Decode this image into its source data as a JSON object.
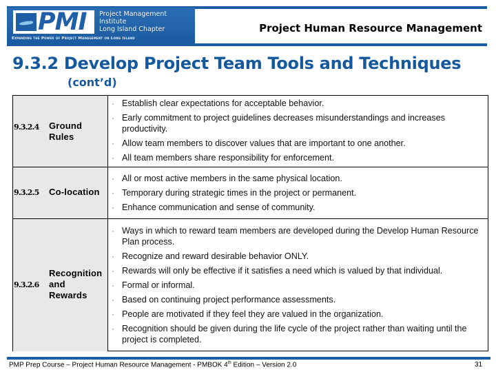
{
  "header": {
    "logo": {
      "letters": "PMI",
      "org_line1": "Project Management Institute",
      "org_line2": "Long Island Chapter",
      "tagline": "Expanding the Power of Project Management on Long Island"
    },
    "section_title": "Project Human Resource Management",
    "brand_color": "#1b5ea8"
  },
  "slide": {
    "title": "9.3.2 Develop Project Team Tools and Techniques",
    "subtitle": "(cont’d)",
    "title_color": "#14589e"
  },
  "table": {
    "rows": [
      {
        "number": "9.3.2.4",
        "name_lines": [
          "Ground",
          "Rules"
        ],
        "bullets": [
          "Establish clear expectations for acceptable behavior.",
          "Early commitment to project guidelines decreases misunderstandings and increases productivity.",
          "Allow team members to discover values that are important to one another.",
          "All team members share responsibility for enforcement."
        ]
      },
      {
        "number": "9.3.2.5",
        "name_lines": [
          "Co-location"
        ],
        "bullets": [
          "All or most active members in the same physical location.",
          "Temporary during strategic times in the project or permanent.",
          "Enhance communication and sense of community."
        ]
      },
      {
        "number": "9.3.2.6",
        "name_lines": [
          "Recognition",
          "and",
          "Rewards"
        ],
        "bullets": [
          "Ways in which to reward team members are developed during the Develop Human Resource Plan process.",
          "Recognize and reward desirable behavior ONLY.",
          "Rewards will only be effective if it satisfies a need which is valued by that individual.",
          "Formal or informal.",
          "Based on continuing project performance assessments.",
          "People are motivated if they feel they are valued in the organization.",
          "Recognition should be given during the life cycle of the project rather than waiting until the project is completed."
        ]
      }
    ]
  },
  "footer": {
    "text_before_sup": "PMP Prep Course – Project Human Resource Management - PMBOK 4",
    "sup": "th",
    "text_after_sup": " Edition – Version 2.0",
    "page_number": "31"
  }
}
